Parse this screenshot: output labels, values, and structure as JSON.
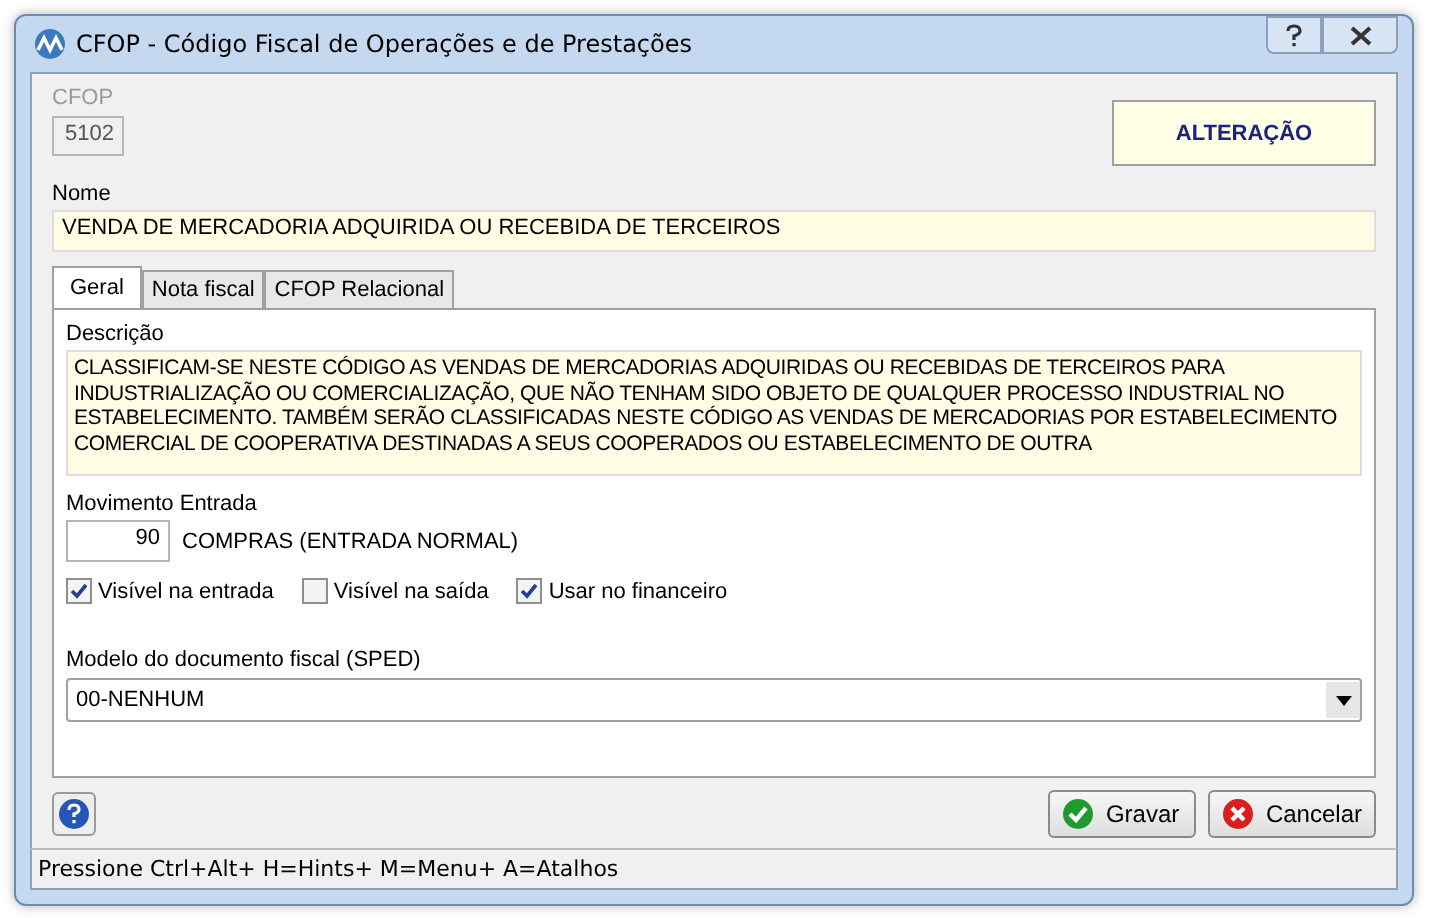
{
  "window": {
    "title": "CFOP - Código Fiscal de Operações e de Prestações"
  },
  "cfop": {
    "label": "CFOP",
    "value": "5102",
    "disabled": true
  },
  "mode_badge": "ALTERAÇÃO",
  "nome": {
    "label": "Nome",
    "value": "VENDA DE MERCADORIA ADQUIRIDA OU RECEBIDA DE TERCEIROS"
  },
  "tabs": [
    {
      "label": "Geral",
      "selected": true
    },
    {
      "label": "Nota fiscal",
      "selected": false
    },
    {
      "label": "CFOP Relacional",
      "selected": false
    }
  ],
  "descricao": {
    "label": "Descrição",
    "value": "CLASSIFICAM-SE NESTE CÓDIGO AS VENDAS DE MERCADORIAS ADQUIRIDAS OU RECEBIDAS DE TERCEIROS PARA INDUSTRIALIZAÇÃO OU COMERCIALIZAÇÃO, QUE NÃO TENHAM SIDO OBJETO DE QUALQUER PROCESSO INDUSTRIAL NO ESTABELECIMENTO. TAMBÉM SERÃO CLASSIFICADAS NESTE CÓDIGO AS VENDAS DE MERCADORIAS POR ESTABELECIMENTO COMERCIAL DE COOPERATIVA DESTINADAS A SEUS COOPERADOS OU ESTABELECIMENTO DE OUTRA"
  },
  "movimento": {
    "label": "Movimento Entrada",
    "code": "90",
    "description": "COMPRAS (ENTRADA NORMAL)"
  },
  "checkboxes": [
    {
      "label": "Visível na entrada",
      "checked": true
    },
    {
      "label": "Visível na saída",
      "checked": false
    },
    {
      "label": "Usar no financeiro",
      "checked": true
    }
  ],
  "modelo": {
    "label": "Modelo do documento fiscal (SPED)",
    "value": "00-NENHUM"
  },
  "buttons": [
    {
      "kind": "save",
      "label": "Gravar"
    },
    {
      "kind": "cancel",
      "label": "Cancelar"
    }
  ],
  "status_bar": "Pressione Ctrl+Alt+ H=Hints+ M=Menu+ A=Atalhos"
}
